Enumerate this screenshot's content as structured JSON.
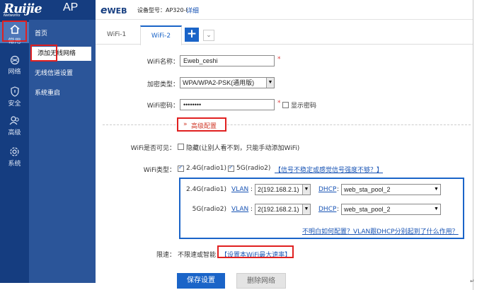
{
  "brand": {
    "logo": "Ruijie",
    "sub": "Networks",
    "model": "AP"
  },
  "header": {
    "eweb": "WEB",
    "device_label": "设备型号：AP320-I",
    "detail": "详细"
  },
  "rail": [
    {
      "label": "常用",
      "icon": "home-icon",
      "active": true
    },
    {
      "label": "网络",
      "icon": "globe-icon"
    },
    {
      "label": "安全",
      "icon": "shield-icon"
    },
    {
      "label": "高级",
      "icon": "users-icon"
    },
    {
      "label": "系统",
      "icon": "gear-icon"
    }
  ],
  "submenu": [
    {
      "label": "首页"
    },
    {
      "label": "添加无线网络",
      "selected": true
    },
    {
      "label": "无线信道设置"
    },
    {
      "label": "系统重启"
    }
  ],
  "tabs": [
    {
      "label": "WiFi-1"
    },
    {
      "label": "WiFi-2",
      "active": true
    }
  ],
  "tab_add": "+",
  "tab_more": "⌄",
  "form": {
    "ssid_label": "WiFi名称：",
    "ssid_value": "Eweb_ceshi",
    "enc_label": "加密类型：",
    "enc_value": "WPA/WPA2-PSK(通用版)",
    "pwd_label": "WiFi密码：",
    "pwd_value": "••••••••",
    "required_mark": "*",
    "show_pwd": "显示密码",
    "advanced": "高级配置",
    "visible_label": "WiFi是否可见：",
    "hidden_text": "隐藏(让别人看不到，只能手动添加WiFi)",
    "type_label": "WiFi类型：",
    "type_24": "2.4G(radio1)",
    "type_5": "5G(radio2)",
    "type_link": "【信号不稳定或感觉信号强度不够？】",
    "limit_label": "限速：",
    "limit_value": "不限速或智能",
    "limit_link": "【设置本WiFi最大速率】"
  },
  "radios": [
    {
      "name": "2.4G(radio1)",
      "vlan_label": "VLAN",
      "vlan": "2(192.168.2.1)",
      "dhcp_label": "DHCP",
      "dhcp": "web_sta_pool_2"
    },
    {
      "name": "5G(radio2)",
      "vlan_label": "VLAN",
      "vlan": "2(192.168.2.1)",
      "dhcp_label": "DHCP",
      "dhcp": "web_sta_pool_2"
    }
  ],
  "panel_link": "不明白如何配置？VLAN跟DHCP分别起到了什么作用？",
  "buttons": {
    "save": "保存设置",
    "delete": "删除网络"
  }
}
